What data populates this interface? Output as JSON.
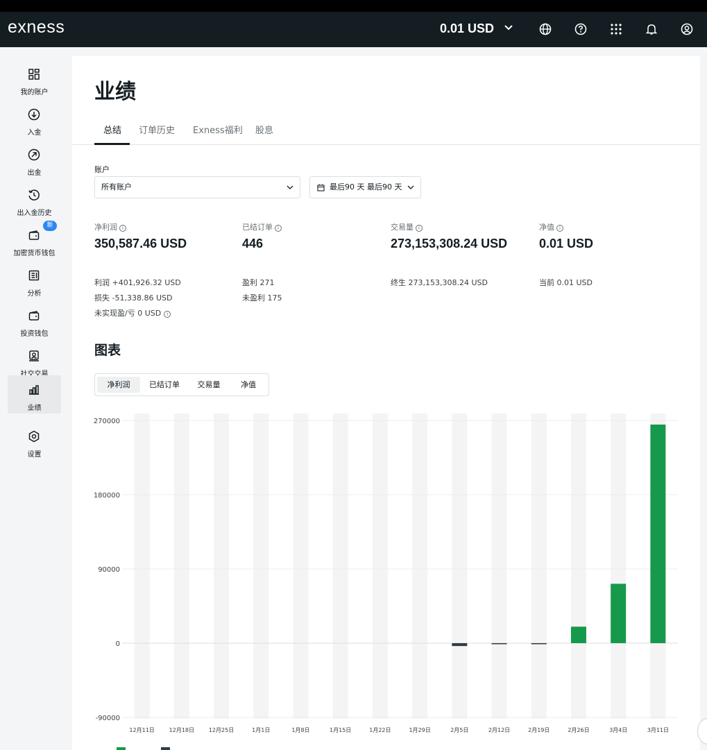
{
  "topbar": {
    "logo": "exness",
    "balance": "0.01 USD",
    "icons": [
      "globe-icon",
      "help-icon",
      "apps-grid-icon",
      "bell-icon",
      "user-icon"
    ]
  },
  "sidebar": {
    "items": [
      {
        "label": "我的账户",
        "icon": "dashboard-icon"
      },
      {
        "label": "入金",
        "icon": "deposit-icon"
      },
      {
        "label": "出金",
        "icon": "withdraw-icon"
      },
      {
        "label": "出入金历史",
        "icon": "history-icon"
      },
      {
        "label": "加密货币钱包",
        "icon": "wallet-icon",
        "badge": "新"
      },
      {
        "label": "分析",
        "icon": "analytics-icon"
      },
      {
        "label": "投资钱包",
        "icon": "wallet-icon"
      },
      {
        "label": "社交交易",
        "icon": "social-trading-icon"
      },
      {
        "label": "业绩",
        "icon": "performance-icon",
        "active": true
      },
      {
        "label": "设置",
        "icon": "settings-icon"
      }
    ]
  },
  "page": {
    "title": "业绩",
    "tabs": [
      "总结",
      "订单历史",
      "Exness福利",
      "股息"
    ],
    "active_tab": "总结"
  },
  "filters": {
    "account_label": "账户",
    "account_value": "所有账户",
    "period_value": "最后90 天 最后90 天"
  },
  "stats": [
    {
      "label": "净利润",
      "value": "350,587.46 USD"
    },
    {
      "label": "已结订单",
      "value": "446"
    },
    {
      "label": "交易量",
      "value": "273,153,308.24 USD"
    },
    {
      "label": "净值",
      "value": "0.01 USD"
    }
  ],
  "details": {
    "profit": "利润 +401,926.32 USD",
    "loss": "损失 -51,338.86 USD",
    "unrealized": "未实现盈/亏 0 USD",
    "profitable": "盈利 271",
    "unprofitable": "未盈利 175",
    "lifetime_volume": "终生 273,153,308.24 USD",
    "current_equity": "当前 0.01 USD"
  },
  "chart_section": {
    "title": "图表",
    "segments": [
      "净利润",
      "已结订单",
      "交易量",
      "净值"
    ],
    "active_segment": "净利润"
  },
  "colors": {
    "positive": "#17994b",
    "negative": "#2e3b48",
    "topbar": "#141d22",
    "badge": "#2a86f5"
  },
  "chart_data": {
    "type": "bar",
    "categories": [
      "12月11日",
      "12月18日",
      "12月25日",
      "1月1日",
      "1月8日",
      "1月15日",
      "1月22日",
      "1月29日",
      "2月5日",
      "2月12日",
      "2月19日",
      "2月26日",
      "3月4日",
      "3月11日"
    ],
    "values": [
      0,
      0,
      0,
      0,
      0,
      0,
      0,
      0,
      -3500,
      -700,
      -700,
      20000,
      72000,
      265000
    ],
    "yticks": [
      270000,
      180000,
      90000,
      0,
      -90000
    ],
    "ylim": [
      -90000,
      270000
    ],
    "grid": true,
    "title": "",
    "xlabel": "",
    "ylabel": ""
  }
}
